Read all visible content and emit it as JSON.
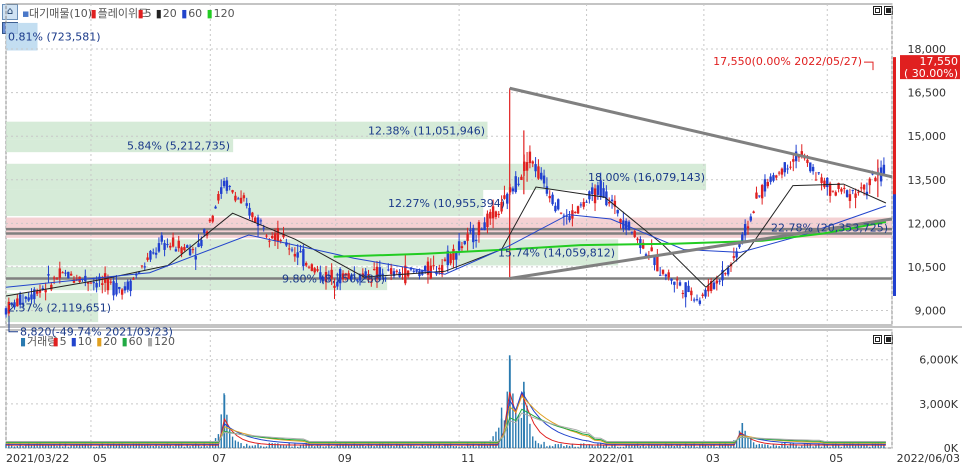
{
  "chart_data": [
    {
      "type": "candlestick",
      "panel": "price",
      "legend": {
        "items": [
          {
            "marker": "▪",
            "label": "대기매물(10)",
            "color": "#4a78c8"
          },
          {
            "marker": "▮",
            "label": "플레이위드",
            "color": "#e02020"
          },
          {
            "marker": "▮",
            "label": "5",
            "color": "#e02020"
          },
          {
            "marker": "▮",
            "label": "20",
            "color": "#222222"
          },
          {
            "marker": "▮",
            "label": "60",
            "color": "#2244cc"
          },
          {
            "marker": "▮",
            "label": "120",
            "color": "#22cc22"
          }
        ]
      },
      "ylim": [
        8500,
        19000
      ],
      "yticks": [
        "18,000",
        "16,500",
        "15,000",
        "13,500",
        "12,000",
        "10,500",
        "9,000"
      ],
      "ytick_values": [
        18000,
        16500,
        15000,
        13500,
        12000,
        10500,
        9000
      ],
      "xlim": [
        "2021/03/22",
        "2022/06/03"
      ],
      "grid": true,
      "current_price": {
        "value": 17550,
        "label": "17,550",
        "pct": "( 30.00%)",
        "color": "#e02020"
      },
      "annotations": {
        "high": "17,550(0.00% 2022/05/27)",
        "low": "8,820(-49.74% 2021/03/23)"
      },
      "volume_profile": [
        {
          "price_low": 17950,
          "price_high": 18900,
          "share": 0.81,
          "label": "0.81% (723,581)",
          "color": "#b8d8ee"
        },
        {
          "price_low": 14900,
          "price_high": 15500,
          "share": 12.38,
          "label": "12.38% (11,051,946)",
          "color": "#cfe8d1"
        },
        {
          "price_low": 14450,
          "price_high": 14900,
          "share": 5.84,
          "label": "5.84% (5,212,735)",
          "color": "#cfe8d1"
        },
        {
          "price_low": 13150,
          "price_high": 14050,
          "share": 18.0,
          "label": "18.00% (16,079,143)",
          "color": "#cfe8d1"
        },
        {
          "price_low": 12250,
          "price_high": 13150,
          "share": 12.27,
          "label": "12.27% (10,955,394)",
          "color": "#cfe8d1"
        },
        {
          "price_low": 11500,
          "price_high": 12200,
          "share": 22.78,
          "label": "22.78% (20,353,725)",
          "color": "#f2c9cb"
        },
        {
          "price_low": 10550,
          "price_high": 11450,
          "share": 15.74,
          "label": "15.74% (14,059,812)",
          "color": "#cfe8d1"
        },
        {
          "price_low": 9700,
          "price_high": 10500,
          "share": 9.8,
          "label": "9.80% (8,750,286)",
          "color": "#cfe8d1"
        },
        {
          "price_low": 8600,
          "price_high": 9600,
          "share": 2.37,
          "label": "2.37% (2,119,651)",
          "color": "#cfe8d1"
        }
      ],
      "horizontal_lines": [
        11800,
        11650,
        10100
      ],
      "trendlines": [
        {
          "from": [
            "2021/11/26",
            16650
          ],
          "to": [
            "2022/06/03",
            13600
          ]
        },
        {
          "from": [
            "2021/11/26",
            10100
          ],
          "to": [
            "2022/06/03",
            12150
          ]
        }
      ],
      "series": [
        {
          "name": "5",
          "color": "#e02020",
          "values": [
            [
              "2021/03/22",
              9050
            ],
            [
              "2021/04/20",
              10250
            ],
            [
              "2021/05/05",
              10000
            ],
            [
              "2021/05/20",
              9750
            ],
            [
              "2021/06/07",
              11300
            ],
            [
              "2021/06/25",
              11100
            ],
            [
              "2021/07/08",
              13400
            ],
            [
              "2021/07/23",
              12200
            ],
            [
              "2021/08/11",
              11100
            ],
            [
              "2021/08/26",
              10150
            ],
            [
              "2021/09/10",
              10200
            ],
            [
              "2021/09/30",
              10250
            ],
            [
              "2021/10/20",
              10400
            ],
            [
              "2021/11/05",
              11400
            ],
            [
              "2021/11/22",
              12500
            ],
            [
              "2021/12/06",
              14300
            ],
            [
              "2021/12/24",
              12100
            ],
            [
              "2022/01/10",
              13200
            ],
            [
              "2022/01/25",
              11800
            ],
            [
              "2022/02/10",
              10300
            ],
            [
              "2022/02/28",
              9400
            ],
            [
              "2022/03/15",
              10500
            ],
            [
              "2022/03/31",
              13200
            ],
            [
              "2022/04/18",
              14400
            ],
            [
              "2022/05/04",
              13100
            ],
            [
              "2022/05/20",
              13100
            ],
            [
              "2022/05/27",
              13700
            ]
          ]
        }
      ],
      "ma": [
        {
          "name": "20",
          "color": "#222222",
          "values": [
            [
              "2021/03/22",
              9500
            ],
            [
              "2021/05/07",
              10050
            ],
            [
              "2021/06/10",
              10550
            ],
            [
              "2021/07/12",
              12350
            ],
            [
              "2021/08/12",
              11450
            ],
            [
              "2021/09/15",
              10150
            ],
            [
              "2021/10/25",
              10350
            ],
            [
              "2021/11/22",
              11100
            ],
            [
              "2021/12/09",
              13250
            ],
            [
              "2022/01/12",
              12900
            ],
            [
              "2022/02/10",
              11250
            ],
            [
              "2022/03/03",
              9800
            ],
            [
              "2022/03/24",
              11100
            ],
            [
              "2022/04/15",
              13300
            ],
            [
              "2022/05/10",
              13350
            ],
            [
              "2022/05/31",
              12700
            ]
          ]
        },
        {
          "name": "60",
          "color": "#2244cc",
          "values": [
            [
              "2021/03/22",
              9800
            ],
            [
              "2021/06/01",
              10300
            ],
            [
              "2021/07/20",
              11600
            ],
            [
              "2021/09/10",
              10800
            ],
            [
              "2021/10/25",
              10250
            ],
            [
              "2021/11/25",
              11200
            ],
            [
              "2021/12/25",
              12300
            ],
            [
              "2022/01/15",
              12150
            ],
            [
              "2022/02/20",
              11100
            ],
            [
              "2022/03/20",
              11000
            ],
            [
              "2022/04/20",
              11600
            ],
            [
              "2022/05/31",
              12600
            ]
          ]
        },
        {
          "name": "120",
          "color": "#22cc22",
          "values": [
            [
              "2021/08/31",
              10850
            ],
            [
              "2021/10/15",
              10950
            ],
            [
              "2021/11/25",
              11100
            ],
            [
              "2021/12/31",
              11250
            ],
            [
              "2022/02/15",
              11300
            ],
            [
              "2022/03/31",
              11400
            ],
            [
              "2022/04/30",
              11650
            ],
            [
              "2022/05/31",
              12050
            ]
          ]
        }
      ]
    },
    {
      "type": "bar",
      "panel": "volume",
      "legend": {
        "items": [
          {
            "marker": "▮",
            "label": "거래량",
            "color": "#2a7ab0"
          },
          {
            "marker": "▮",
            "label": "5",
            "color": "#e02020"
          },
          {
            "marker": "▮",
            "label": "10",
            "color": "#2244cc"
          },
          {
            "marker": "▮",
            "label": "20",
            "color": "#e0a020"
          },
          {
            "marker": "▮",
            "label": "60",
            "color": "#22aa44"
          },
          {
            "marker": "▮",
            "label": "120",
            "color": "#aaaaaa"
          }
        ]
      },
      "ylim": [
        0,
        7000000
      ],
      "yticks": [
        "6,000K",
        "3,000K",
        "0K"
      ],
      "ytick_values": [
        6000000,
        3000000,
        0
      ],
      "peaks": [
        [
          "2021/07/08",
          3600000
        ],
        [
          "2021/11/26",
          6300000
        ],
        [
          "2021/12/03",
          4500000
        ],
        [
          "2022/03/21",
          1700000
        ],
        [
          "2021/11/22",
          2000000
        ]
      ]
    }
  ],
  "x_axis": {
    "labels": [
      {
        "date": "2021/03/22",
        "text": "2021/03/22"
      },
      {
        "date": "2021/05/03",
        "text": "05"
      },
      {
        "date": "2021/07/01",
        "text": "07"
      },
      {
        "date": "2021/09/01",
        "text": "09"
      },
      {
        "date": "2021/11/01",
        "text": "11"
      },
      {
        "date": "2022/01/03",
        "text": "2022/01"
      },
      {
        "date": "2022/03/02",
        "text": "03"
      },
      {
        "date": "2022/05/02",
        "text": "05"
      },
      {
        "date": "2022/06/03",
        "text": "2022/06/03"
      }
    ]
  }
}
